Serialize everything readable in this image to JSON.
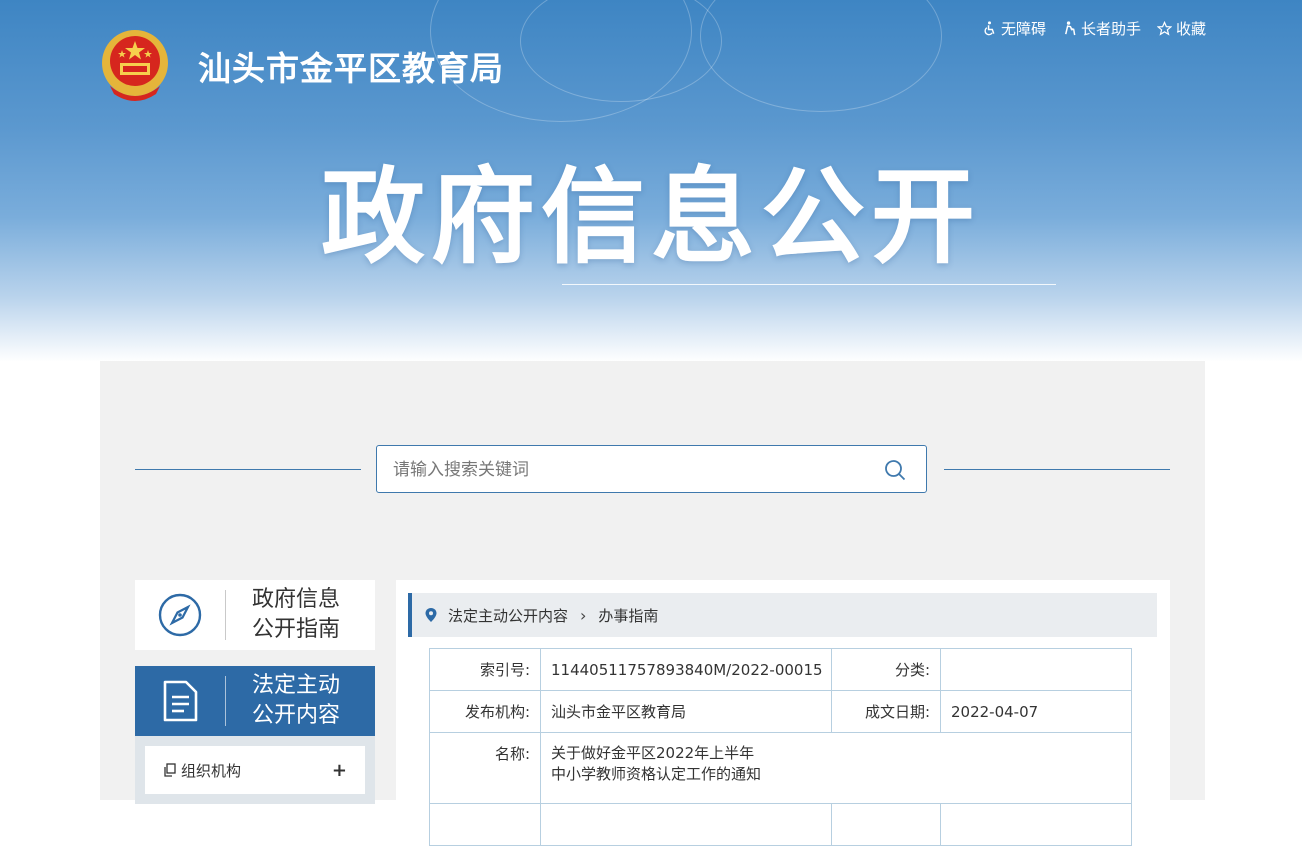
{
  "header": {
    "site_title": "汕头市金平区教育局",
    "hero_title": "政府信息公开",
    "links": [
      {
        "label": "无障碍",
        "icon": "accessibility-icon"
      },
      {
        "label": "长者助手",
        "icon": "elder-helper-icon"
      },
      {
        "label": "收藏",
        "icon": "star-icon"
      }
    ]
  },
  "search": {
    "placeholder": "请输入搜索关键词"
  },
  "sidebar": {
    "guide": {
      "line1": "政府信息",
      "line2": "公开指南",
      "icon": "compass-icon"
    },
    "statutory": {
      "line1": "法定主动",
      "line2": "公开内容",
      "icon": "document-icon"
    },
    "submenu": [
      {
        "label": "组织机构",
        "expand": "+",
        "icon": "copy-icon"
      }
    ]
  },
  "breadcrumb": {
    "level1": "法定主动公开内容",
    "separator": "›",
    "level2": "办事指南"
  },
  "info_table": {
    "index_label": "索引号:",
    "index_value": "11440511757893840M/2022-00015",
    "category_label": "分类:",
    "category_value": "",
    "publisher_label": "发布机构:",
    "publisher_value": "汕头市金平区教育局",
    "date_label": "成文日期:",
    "date_value": "2022-04-07",
    "name_label": "名称:",
    "name_line1": "关于做好金平区2022年上半年",
    "name_line2": "中小学教师资格认定工作的通知"
  },
  "colors": {
    "primary_blue": "#2d6aa6",
    "header_blue": "#3e85c3",
    "panel_bg": "#f1f1f1"
  }
}
